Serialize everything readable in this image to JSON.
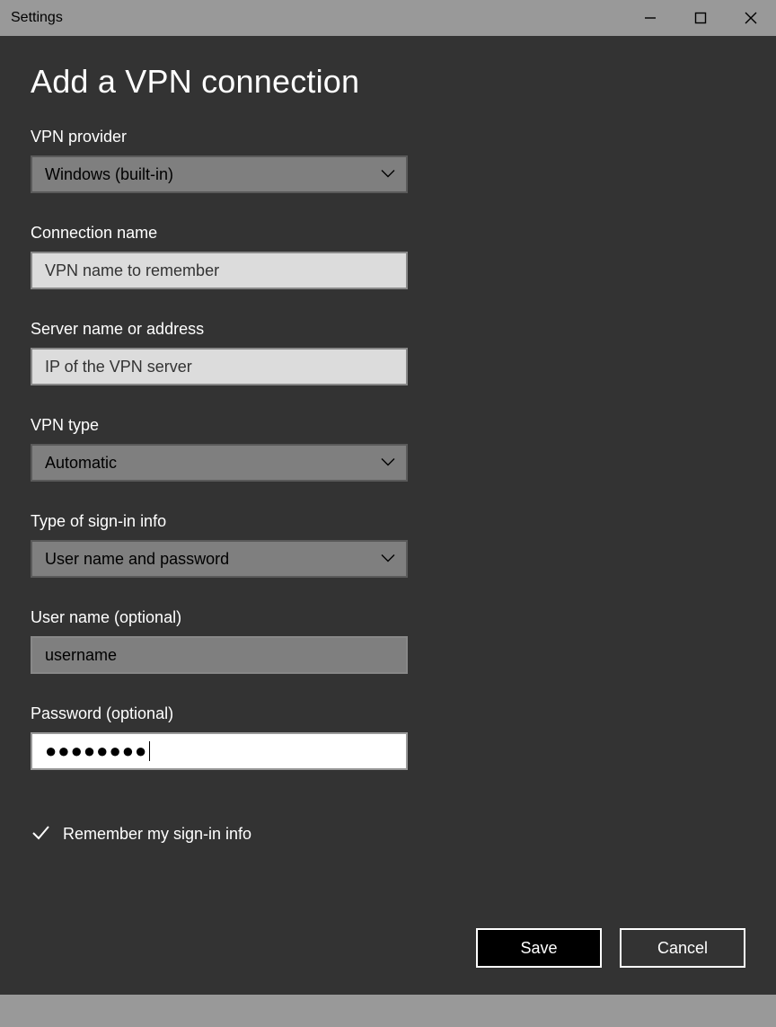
{
  "window": {
    "title": "Settings"
  },
  "page": {
    "heading": "Add a VPN connection"
  },
  "fields": {
    "vpn_provider": {
      "label": "VPN provider",
      "value": "Windows (built-in)"
    },
    "connection_name": {
      "label": "Connection name",
      "value": "VPN name to remember"
    },
    "server": {
      "label": "Server name or address",
      "value": "IP of the VPN server"
    },
    "vpn_type": {
      "label": "VPN type",
      "value": "Automatic"
    },
    "signin_type": {
      "label": "Type of sign-in info",
      "value": "User name and password"
    },
    "username": {
      "label": "User name (optional)",
      "value": "username"
    },
    "password": {
      "label": "Password (optional)",
      "value": "●●●●●●●●"
    }
  },
  "checkbox": {
    "remember_label": "Remember my sign-in info"
  },
  "buttons": {
    "save": "Save",
    "cancel": "Cancel"
  }
}
